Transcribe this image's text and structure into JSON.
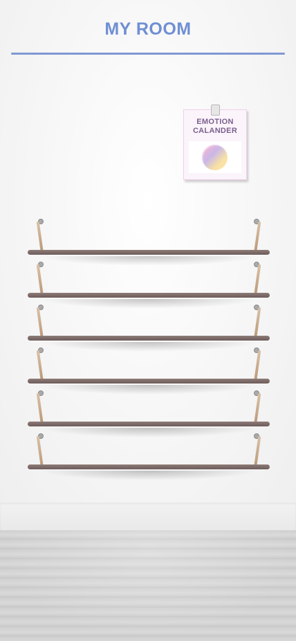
{
  "header": {
    "title": "MY ROOM"
  },
  "calendar": {
    "title": "EMOTION CALANDER",
    "badge_colors": [
      "#e8b6d8",
      "#c9b7e8",
      "#ffe7a0"
    ]
  },
  "shelves": {
    "count": 6
  },
  "colors": {
    "accent": "#6f8fd3",
    "shelf_board": "#7a6967",
    "strap": "#c9a889"
  },
  "icons": {
    "calendar_pin": "pin-icon",
    "emotion_badge": "emotion-gradient-circle-icon"
  }
}
